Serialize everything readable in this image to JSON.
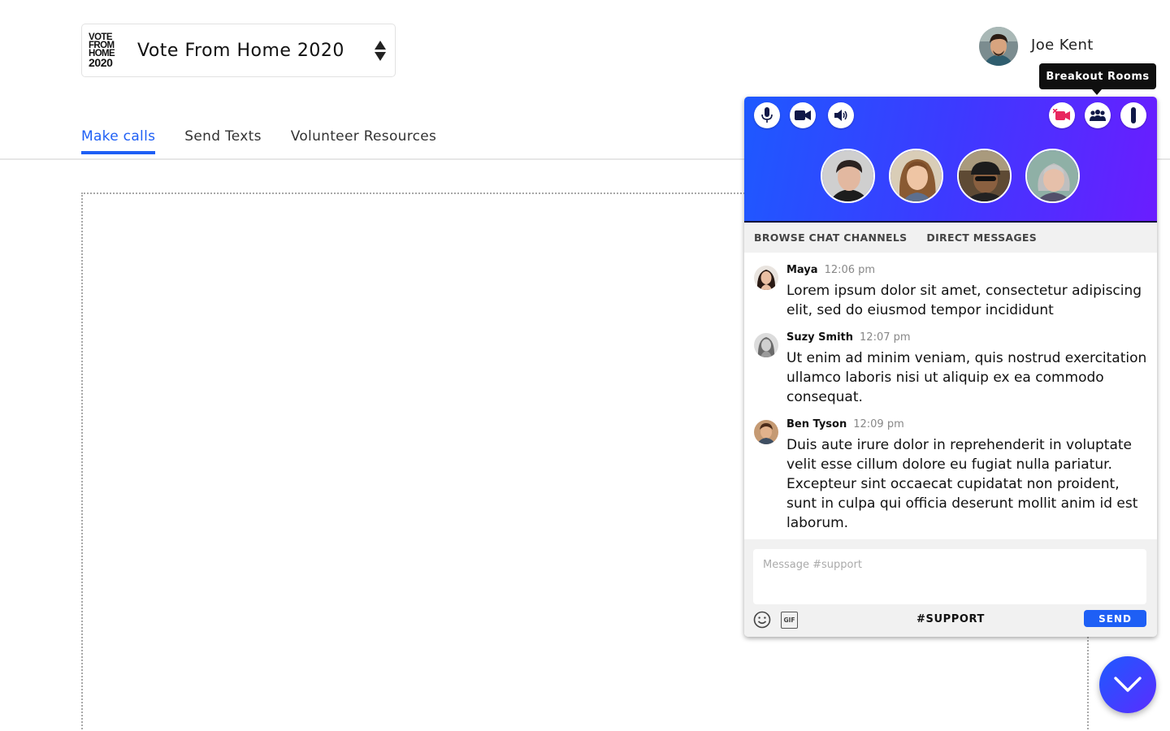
{
  "org": {
    "logo_lines": [
      "VOTE",
      "FROM",
      "HOME",
      "2020"
    ],
    "name": "Vote From Home 2020"
  },
  "user": {
    "name": "Joe Kent"
  },
  "tabs": [
    {
      "label": "Make calls",
      "active": true
    },
    {
      "label": "Send Texts",
      "active": false
    },
    {
      "label": "Volunteer Resources",
      "active": false
    }
  ],
  "tooltip": {
    "text": "Breakout Rooms"
  },
  "panel": {
    "controls_left": [
      "microphone-icon",
      "video-camera-icon",
      "speaker-icon"
    ],
    "controls_right": [
      "video-off-icon",
      "breakout-rooms-icon",
      "vertical-bar-icon"
    ],
    "participant_count": 4,
    "chat_tabs": [
      "BROWSE CHAT CHANNELS",
      "DIRECT MESSAGES"
    ],
    "messages": [
      {
        "author": "Maya",
        "time": "12:06 pm",
        "text": "Lorem ipsum dolor sit amet, consectetur adipiscing elit, sed do eiusmod tempor incididunt"
      },
      {
        "author": "Suzy Smith",
        "time": "12:07 pm",
        "text": "Ut enim ad minim veniam, quis nostrud exercitation ullamco laboris nisi ut aliquip ex ea commodo consequat."
      },
      {
        "author": "Ben Tyson",
        "time": "12:09 pm",
        "text": "Duis aute irure dolor in reprehenderit in voluptate velit esse cillum dolore eu fugiat nulla pariatur. Excepteur sint occaecat cupidatat non proident, sunt in culpa qui officia deserunt mollit anim id est laborum."
      }
    ],
    "compose": {
      "placeholder": "Message #support",
      "value": "",
      "gif_label": "GIF",
      "channel": "#SUPPORT",
      "send_label": "SEND"
    }
  },
  "colors": {
    "accent": "#1e5ff5",
    "header_gradient_start": "#1e59ff",
    "header_gradient_end": "#6a1dff",
    "video_off": "#e8265e"
  }
}
